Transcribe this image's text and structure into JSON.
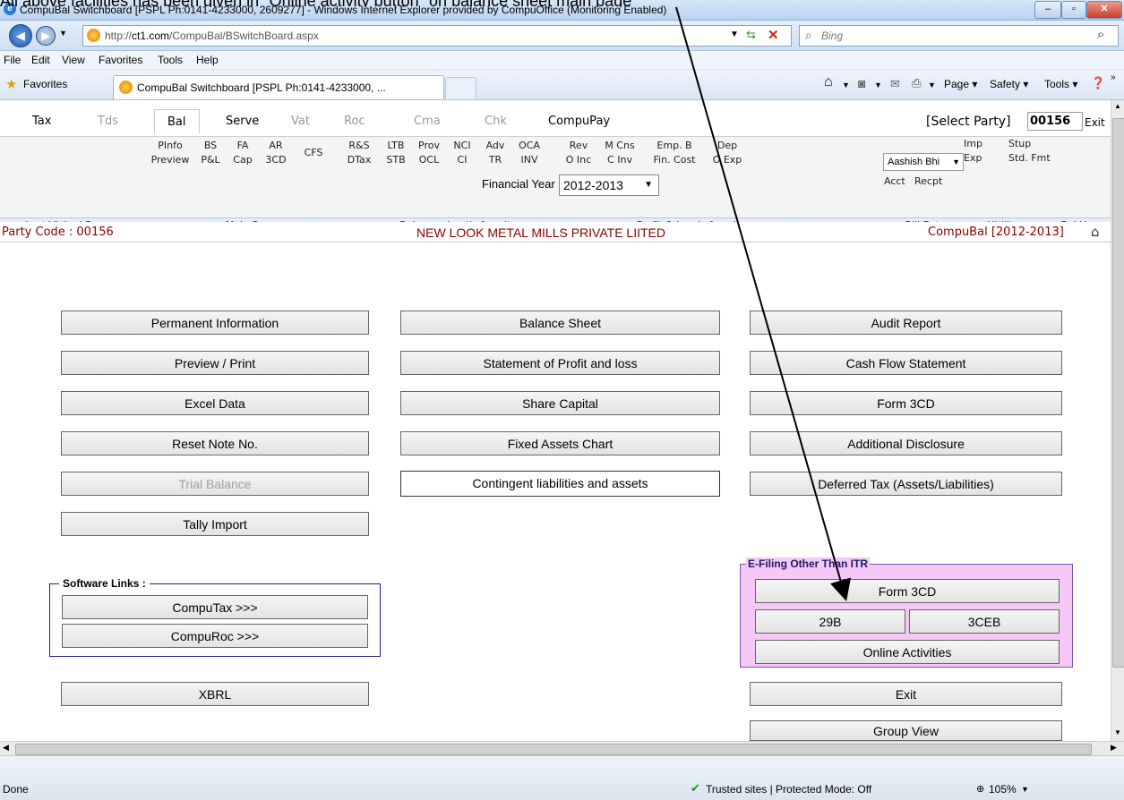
{
  "caption": "All above facilities has been given in \"Online activity button\" on balance sheet main page",
  "window": {
    "title": "CompuBal Switchboard [PSPL Ph:0141-4233000, 2609277] - Windows Internet Explorer provided by CompuOffice (Monitoring Enabled)",
    "url_prefix": "http://",
    "url_domain": "ct1.com",
    "url_path": "/CompuBal/BSwitchBoard.aspx",
    "search_placeholder": "Bing"
  },
  "menu": [
    "File",
    "Edit",
    "View",
    "Favorites",
    "Tools",
    "Help"
  ],
  "favorites_label": "Favorites",
  "tab_title": "CompuBal Switchboard [PSPL Ph:0141-4233000, ...",
  "commands": {
    "page": "Page",
    "safety": "Safety",
    "tools": "Tools"
  },
  "ribbon": {
    "tabs": [
      "Tax",
      "Tds",
      "Bal",
      "Serve",
      "Vat",
      "Roc",
      "Cma",
      "Chk",
      "CompuPay"
    ],
    "select_party_label": "[Select Party]",
    "party_code_value": "00156",
    "exit_label": "Exit",
    "bill_entry_dropdown": "Aashish Bhi",
    "bill_acct": "Acct",
    "bill_recpt": "Recpt",
    "items": [
      [
        "PInfo",
        "Preview"
      ],
      [
        "BS",
        "P&L"
      ],
      [
        "FA",
        "Cap"
      ],
      [
        "AR",
        "3CD"
      ],
      [
        "CFS",
        ""
      ],
      [
        "R&S",
        "DTax"
      ],
      [
        "LTB",
        "STB"
      ],
      [
        "Prov",
        "OCL"
      ],
      [
        "NCI",
        "CI"
      ],
      [
        "Adv",
        "TR"
      ],
      [
        "OCA",
        "INV"
      ],
      [
        "Rev",
        "O Inc"
      ],
      [
        "M Cns",
        "C Inv"
      ],
      [
        "Emp. B",
        "Fin. Cost"
      ],
      [
        "Dep",
        "O Exp"
      ],
      [
        "Imp",
        "Exp"
      ],
      [
        "Stup",
        "Std. Fmt"
      ]
    ],
    "groups": [
      "Last Visited Page",
      "Main Page",
      "Balance sheet's face items",
      "Profit & Loss's face items",
      "Bill Entry",
      "Uitility",
      "Bal Home"
    ]
  },
  "info": {
    "party_code": "Party Code : 00156",
    "company": "NEW LOOK METAL MILLS PRIVATE LIITED",
    "product": "CompuBal [2012-2013]"
  },
  "financial_year": {
    "label": "Financial Year :",
    "value": "2012-2013"
  },
  "buttons": {
    "col1": [
      "Permanent Information",
      "Preview / Print",
      "Excel Data",
      "Reset Note No.",
      "Trial Balance",
      "Tally Import"
    ],
    "col2": [
      "Balance Sheet",
      "Statement of Profit and loss",
      "Share Capital",
      "Fixed Assets Chart",
      "Contingent liabilities and assets"
    ],
    "col3": [
      "Audit Report",
      "Cash Flow Statement",
      "Form 3CD",
      "Additional Disclosure",
      "Deferred Tax (Assets/Liabilities)"
    ],
    "xbrl": "XBRL",
    "exit": "Exit",
    "group_view": "Group View"
  },
  "software_links": {
    "legend": "Software Links :",
    "items": [
      "CompuTax >>>",
      "CompuRoc >>>"
    ]
  },
  "efiling": {
    "legend": "E-Filing Other Than ITR",
    "form3cd": "Form 3CD",
    "b29": "29B",
    "ceb3": "3CEB",
    "online": "Online Activities"
  },
  "status": {
    "done": "Done",
    "zone": "Trusted sites | Protected Mode: Off",
    "zoom": "105%"
  }
}
